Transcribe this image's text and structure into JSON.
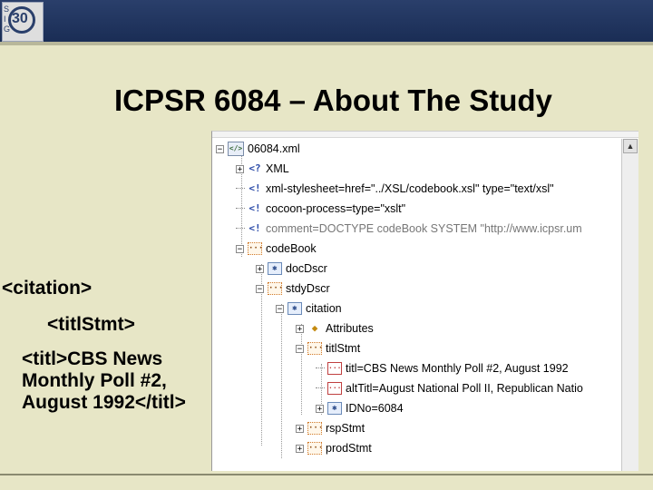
{
  "slide": {
    "title": "ICPSR 6084 – About The Study",
    "logo_text": "30",
    "logo_side": "S I G"
  },
  "left_panel": {
    "line1": "<citation>",
    "line2": "<titlStmt>",
    "line3": "<titl>CBS News Monthly Poll #2, August 1992</titl>"
  },
  "tree": {
    "rows": [
      {
        "label": "06084.xml"
      },
      {
        "label": "XML",
        "icon": "<?"
      },
      {
        "label": "xml-stylesheet=href=\"../XSL/codebook.xsl\" type=\"text/xsl\"",
        "icon": "<!"
      },
      {
        "label": "cocoon-process=type=\"xslt\"",
        "icon": "<!"
      },
      {
        "label": "comment=DOCTYPE codeBook SYSTEM \"http://www.icpsr.um",
        "icon": "<!"
      },
      {
        "label": "codeBook"
      },
      {
        "label": "docDscr"
      },
      {
        "label": "stdyDscr"
      },
      {
        "label": "citation"
      },
      {
        "label": "Attributes"
      },
      {
        "label": "titlStmt"
      },
      {
        "label": "titl=CBS News Monthly Poll #2, August 1992"
      },
      {
        "label": "altTitl=August National Poll II, Republican Natio"
      },
      {
        "label": "IDNo=6084"
      },
      {
        "label": "rspStmt"
      },
      {
        "label": "prodStmt"
      }
    ]
  }
}
